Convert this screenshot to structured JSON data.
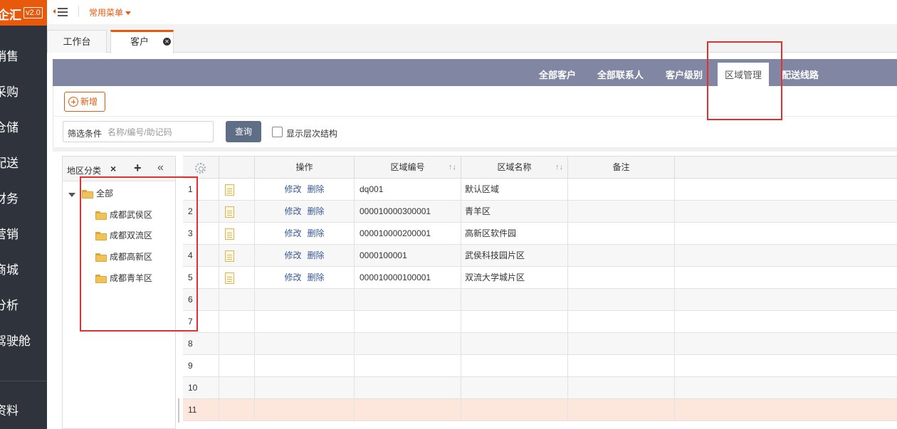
{
  "app": {
    "logo": "企汇",
    "version": "v2.0",
    "common_menu": "常用菜单"
  },
  "sidebar": {
    "items": [
      {
        "label": "销售"
      },
      {
        "label": "采购"
      },
      {
        "label": "仓储"
      },
      {
        "label": "配送"
      },
      {
        "label": "财务"
      },
      {
        "label": "营销"
      },
      {
        "label": "商城"
      },
      {
        "label": "分析"
      },
      {
        "label": "驾驶舱"
      },
      {
        "label": "资料"
      }
    ]
  },
  "page_tabs": [
    {
      "label": "工作台"
    },
    {
      "label": "客户"
    }
  ],
  "sub_tabs": [
    {
      "label": "全部客户"
    },
    {
      "label": "全部联系人"
    },
    {
      "label": "客户级别"
    },
    {
      "label": "区域管理"
    },
    {
      "label": "配送线路"
    }
  ],
  "toolbar": {
    "add_label": "新增",
    "filter_label": "筛选条件",
    "filter_placeholder": "名称/编号/助记码",
    "query_label": "查询",
    "checkbox_label": "显示层次结构"
  },
  "tree": {
    "title": "地区分类",
    "close_glyph": "×",
    "add_glyph": "+",
    "collapse_glyph": "«",
    "root": "全部",
    "children": [
      "成都武侯区",
      "成都双流区",
      "成都高新区",
      "成都青羊区"
    ]
  },
  "grid": {
    "headers": {
      "op": "操作",
      "code": "区域编号",
      "name": "区域名称",
      "note": "备注"
    },
    "sort_glyph": "↑↓",
    "edit_label": "修改",
    "delete_label": "删除",
    "rows": [
      {
        "num": "1",
        "code": "dq001",
        "name": "默认区域"
      },
      {
        "num": "2",
        "code": "000010000300001",
        "name": "青羊区"
      },
      {
        "num": "3",
        "code": "000010000200001",
        "name": "高新区软件园"
      },
      {
        "num": "4",
        "code": "0000100001",
        "name": "武侯科技园片区"
      },
      {
        "num": "5",
        "code": "000010000100001",
        "name": "双流大学城片区"
      }
    ],
    "empty_rows": [
      "6",
      "7",
      "8",
      "9",
      "10",
      "11"
    ]
  },
  "colors": {
    "accent": "#e8590c",
    "nav_band": "#8187a3",
    "sidebar_bg": "#2f333c",
    "highlight": "#e03030"
  }
}
